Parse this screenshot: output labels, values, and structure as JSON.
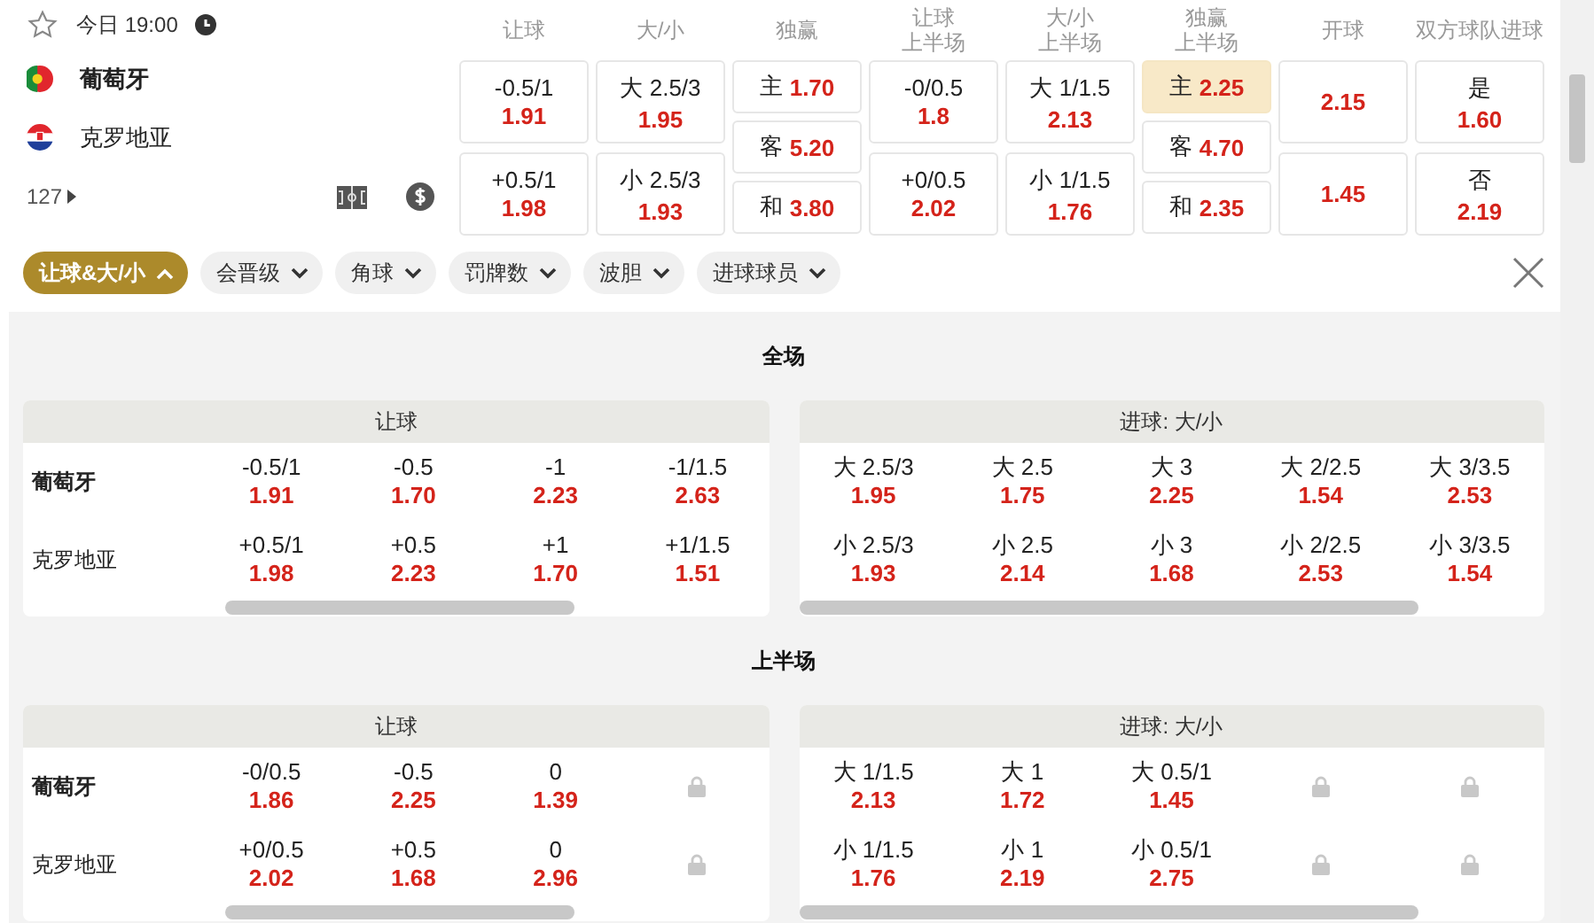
{
  "match": {
    "time": "今日 19:00",
    "teams": [
      "葡萄牙",
      "克罗地亚"
    ],
    "count": "127"
  },
  "markets": [
    {
      "header": [
        "让球"
      ],
      "kind": "two",
      "options": [
        {
          "label": "-0.5/1",
          "odds": "1.91",
          "selected": false
        },
        {
          "label": "+0.5/1",
          "odds": "1.98",
          "selected": false
        }
      ]
    },
    {
      "header": [
        "大/小"
      ],
      "kind": "two",
      "options": [
        {
          "label": "大 2.5/3",
          "odds": "1.95",
          "selected": false
        },
        {
          "label": "小 2.5/3",
          "odds": "1.93",
          "selected": false
        }
      ]
    },
    {
      "header": [
        "独赢"
      ],
      "kind": "three",
      "options": [
        {
          "label": "主",
          "odds": "1.70",
          "selected": false
        },
        {
          "label": "客",
          "odds": "5.20",
          "selected": false
        },
        {
          "label": "和",
          "odds": "3.80",
          "selected": false
        }
      ]
    },
    {
      "header": [
        "让球",
        "上半场"
      ],
      "kind": "two",
      "options": [
        {
          "label": "-0/0.5",
          "odds": "1.8",
          "selected": false
        },
        {
          "label": "+0/0.5",
          "odds": "2.02",
          "selected": false
        }
      ]
    },
    {
      "header": [
        "大/小",
        "上半场"
      ],
      "kind": "two",
      "options": [
        {
          "label": "大 1/1.5",
          "odds": "2.13",
          "selected": false
        },
        {
          "label": "小 1/1.5",
          "odds": "1.76",
          "selected": false
        }
      ]
    },
    {
      "header": [
        "独赢",
        "上半场"
      ],
      "kind": "three",
      "options": [
        {
          "label": "主",
          "odds": "2.25",
          "selected": true
        },
        {
          "label": "客",
          "odds": "4.70",
          "selected": false
        },
        {
          "label": "和",
          "odds": "2.35",
          "selected": false
        }
      ]
    },
    {
      "header": [
        "开球"
      ],
      "kind": "two",
      "options": [
        {
          "odds": "2.15",
          "selected": false
        },
        {
          "odds": "1.45",
          "selected": false
        }
      ]
    },
    {
      "header": [
        "双方球队进球"
      ],
      "kind": "two",
      "options": [
        {
          "label": "是",
          "odds": "1.60",
          "selected": false
        },
        {
          "label": "否",
          "odds": "2.19",
          "selected": false
        }
      ]
    }
  ],
  "filters": [
    {
      "label": "让球&大/小",
      "selected": true
    },
    {
      "label": "会晋级",
      "selected": false
    },
    {
      "label": "角球",
      "selected": false
    },
    {
      "label": "罚牌数",
      "selected": false
    },
    {
      "label": "波胆",
      "selected": false
    },
    {
      "label": "进球球员",
      "selected": false
    }
  ],
  "sections": [
    {
      "title": "全场",
      "tables": [
        {
          "header": "让球",
          "kind": "handicap",
          "row_labels": [
            "葡萄牙",
            "克罗地亚"
          ],
          "columns": [
            [
              {
                "label": "-0.5/1",
                "odds": "1.91"
              },
              {
                "label": "+0.5/1",
                "odds": "1.98"
              }
            ],
            [
              {
                "label": "-0.5",
                "odds": "1.70"
              },
              {
                "label": "+0.5",
                "odds": "2.23"
              }
            ],
            [
              {
                "label": "-1",
                "odds": "2.23"
              },
              {
                "label": "+1",
                "odds": "1.70"
              }
            ],
            [
              {
                "label": "-1/1.5",
                "odds": "2.63"
              },
              {
                "label": "+1/1.5",
                "odds": "1.51"
              }
            ]
          ]
        },
        {
          "header": "进球: 大/小",
          "kind": "totals",
          "columns": [
            [
              {
                "label": "大 2.5/3",
                "odds": "1.95"
              },
              {
                "label": "小 2.5/3",
                "odds": "1.93"
              }
            ],
            [
              {
                "label": "大 2.5",
                "odds": "1.75"
              },
              {
                "label": "小 2.5",
                "odds": "2.14"
              }
            ],
            [
              {
                "label": "大 3",
                "odds": "2.25"
              },
              {
                "label": "小 3",
                "odds": "1.68"
              }
            ],
            [
              {
                "label": "大 2/2.5",
                "odds": "1.54"
              },
              {
                "label": "小 2/2.5",
                "odds": "2.53"
              }
            ],
            [
              {
                "label": "大 3/3.5",
                "odds": "2.53"
              },
              {
                "label": "小 3/3.5",
                "odds": "1.54"
              }
            ]
          ]
        }
      ]
    },
    {
      "title": "上半场",
      "tables": [
        {
          "header": "让球",
          "kind": "handicap",
          "row_labels": [
            "葡萄牙",
            "克罗地亚"
          ],
          "columns": [
            [
              {
                "label": "-0/0.5",
                "odds": "1.86"
              },
              {
                "label": "+0/0.5",
                "odds": "2.02"
              }
            ],
            [
              {
                "label": "-0.5",
                "odds": "2.25"
              },
              {
                "label": "+0.5",
                "odds": "1.68"
              }
            ],
            [
              {
                "label": "0",
                "odds": "1.39"
              },
              {
                "label": "0",
                "odds": "2.96"
              }
            ],
            [
              {
                "locked": true
              },
              {
                "locked": true
              }
            ]
          ]
        },
        {
          "header": "进球: 大/小",
          "kind": "totals",
          "columns": [
            [
              {
                "label": "大 1/1.5",
                "odds": "2.13"
              },
              {
                "label": "小 1/1.5",
                "odds": "1.76"
              }
            ],
            [
              {
                "label": "大 1",
                "odds": "1.72"
              },
              {
                "label": "小 1",
                "odds": "2.19"
              }
            ],
            [
              {
                "label": "大 0.5/1",
                "odds": "1.45"
              },
              {
                "label": "小 0.5/1",
                "odds": "2.75"
              }
            ],
            [
              {
                "locked": true
              },
              {
                "locked": true
              }
            ],
            [
              {
                "locked": true
              },
              {
                "locked": true
              }
            ]
          ]
        }
      ]
    }
  ]
}
